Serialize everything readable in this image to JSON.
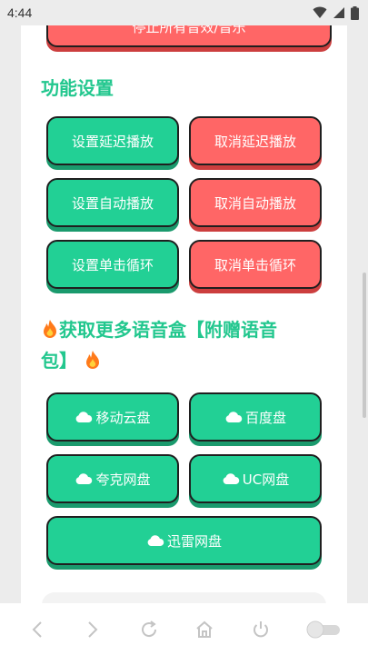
{
  "status": {
    "time": "4:44"
  },
  "top_button": {
    "label": "停止所有音效/音乐"
  },
  "settings": {
    "title": "功能设置",
    "buttons": [
      {
        "label": "设置延迟播放"
      },
      {
        "label": "取消延迟播放"
      },
      {
        "label": "设置自动播放"
      },
      {
        "label": "取消自动播放"
      },
      {
        "label": "设置单击循环"
      },
      {
        "label": "取消单击循环"
      }
    ]
  },
  "more": {
    "title_line1": "获取更多语音盒【附赠语音",
    "title_line2": "包】",
    "buttons": [
      {
        "label": "移动云盘"
      },
      {
        "label": "百度盘"
      },
      {
        "label": "夸克网盘"
      },
      {
        "label": "UC网盘"
      },
      {
        "label": "迅雷网盘"
      }
    ]
  },
  "colors": {
    "green": "#22d095",
    "red": "#ff6666",
    "title": "#22c78e"
  }
}
